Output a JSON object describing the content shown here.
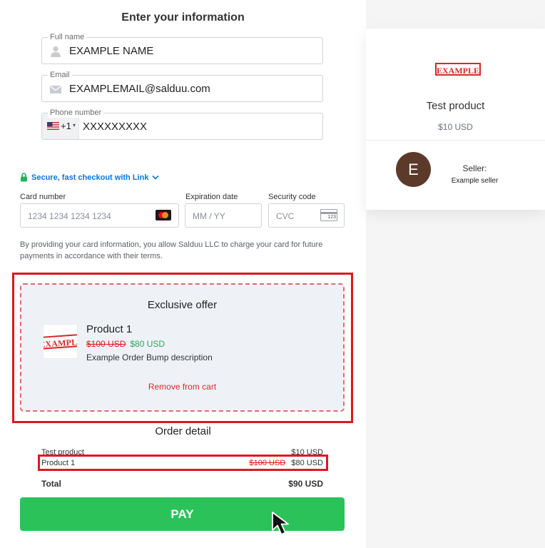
{
  "form": {
    "heading": "Enter your information",
    "full_name_label": "Full name",
    "full_name_value": "EXAMPLE NAME",
    "email_label": "Email",
    "email_value": "EXAMPLEMAIL@salduu.com",
    "phone_label": "Phone number",
    "phone_country_code": "+1",
    "phone_value": "XXXXXXXXX",
    "link_text": "Secure, fast checkout with Link"
  },
  "card": {
    "number_label": "Card number",
    "number_placeholder": "1234 1234 1234 1234",
    "expiry_label": "Expiration date",
    "expiry_placeholder": "MM / YY",
    "cvc_label": "Security code",
    "cvc_placeholder": "CVC",
    "cvc_icon_text": "123",
    "consent_text": "By providing your card information, you allow Salduu LLC to charge your card for future payments in accordance with their terms."
  },
  "offer": {
    "title": "Exclusive offer",
    "product_name": "Product 1",
    "image_text": "EXAMPLE",
    "old_price": "$100 USD",
    "new_price": "$80 USD",
    "description": "Example Order Bump description",
    "remove_label": "Remove from cart"
  },
  "order": {
    "title": "Order detail",
    "items": [
      {
        "name": "Test product",
        "price": "$10 USD"
      },
      {
        "name": "Product 1",
        "old_price": "$100 USD",
        "price": "$80 USD"
      }
    ],
    "total_label": "Total",
    "total_value": "$90 USD",
    "pay_label": "PAY"
  },
  "summary": {
    "seal_text": "EXAMPLE",
    "product_name": "Test product",
    "product_price": "$10 USD",
    "seller_initial": "E",
    "seller_label": "Seller:",
    "seller_name": "Example seller"
  },
  "colors": {
    "pay_button": "#2cc25a",
    "highlight_red": "#e0161f",
    "link_blue": "#0f73d6",
    "offer_bg": "#eef2f7"
  }
}
